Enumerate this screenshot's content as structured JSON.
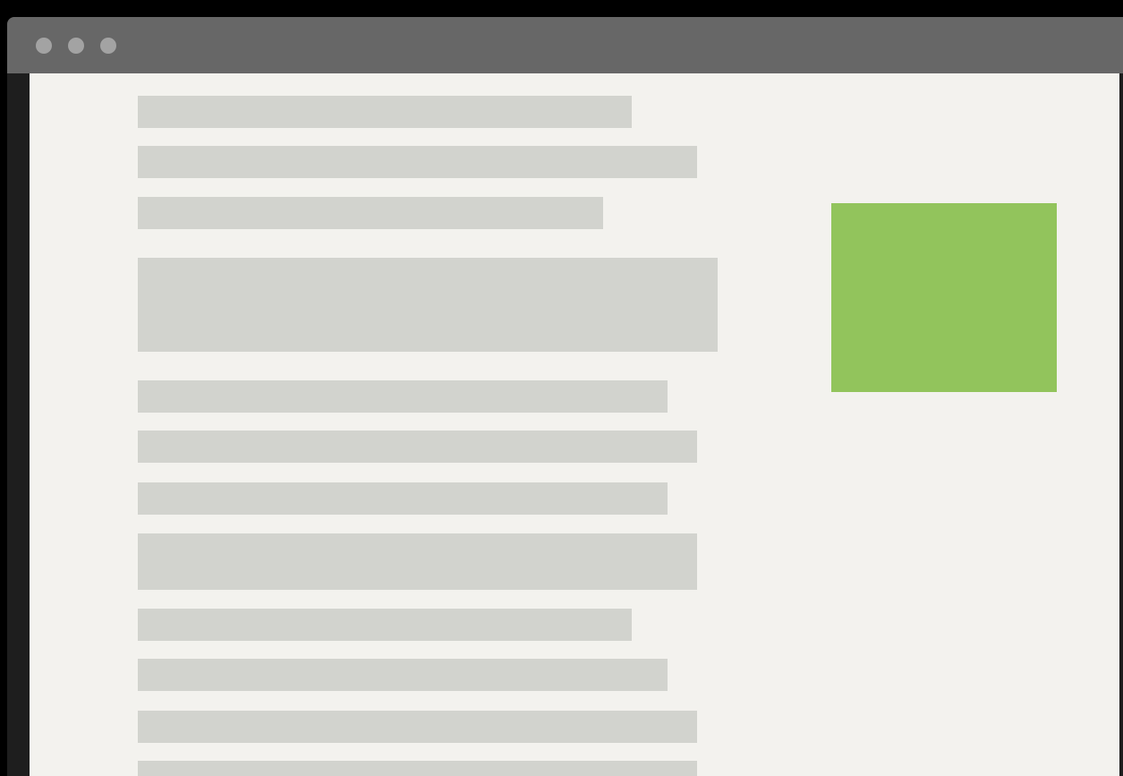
{
  "window": {
    "titlebar_color": "#676767",
    "traffic_lights": [
      "close-button",
      "minimize-button",
      "maximize-button"
    ],
    "traffic_light_color": "#a3a3a3"
  },
  "content": {
    "background_color": "#f3f2ee",
    "placeholder_bar_color": "#d2d3ce",
    "image_placeholder": {
      "color": "#92c45c",
      "icon": "image-placeholder"
    }
  }
}
